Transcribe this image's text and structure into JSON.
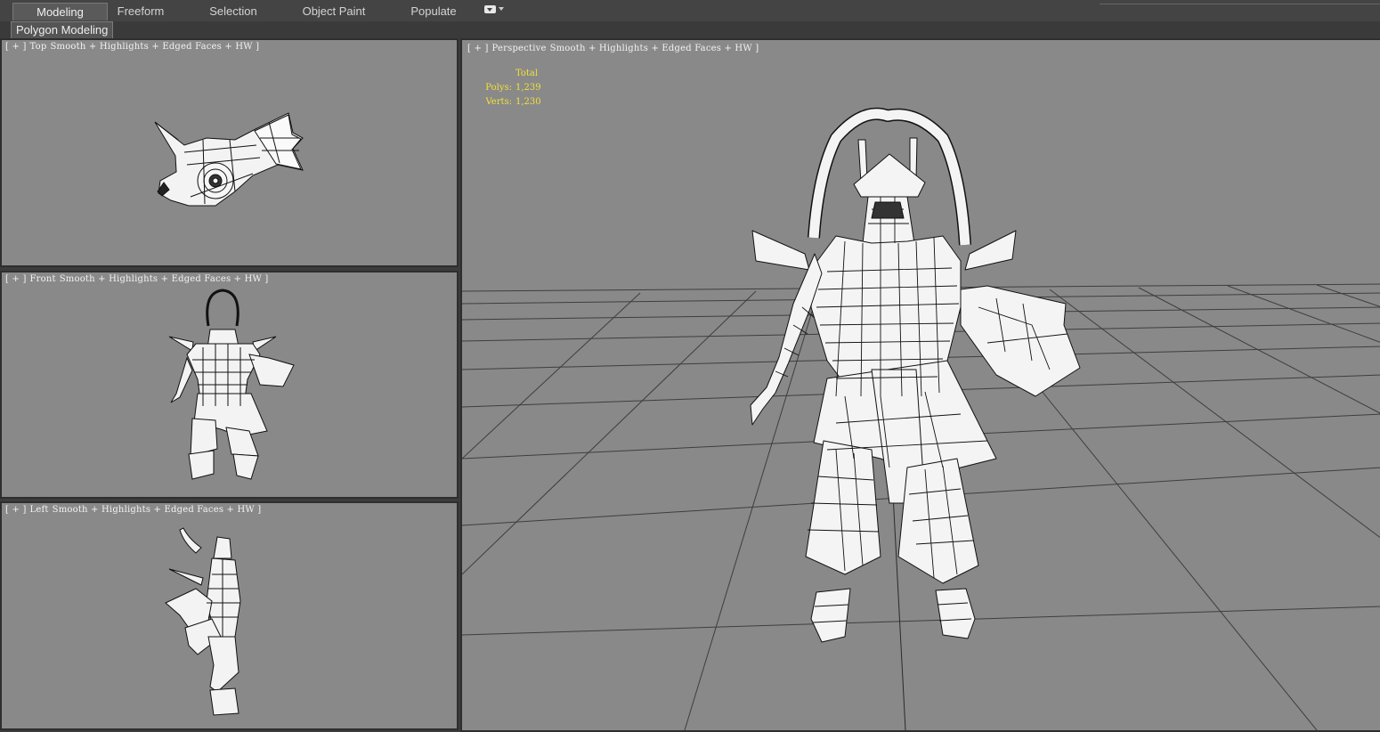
{
  "ribbon": {
    "tabs": [
      {
        "label": "Modeling",
        "active": true
      },
      {
        "label": "Freeform",
        "active": false
      },
      {
        "label": "Selection",
        "active": false
      },
      {
        "label": "Object Paint",
        "active": false
      },
      {
        "label": "Populate",
        "active": false
      }
    ],
    "options_icon": "ribbon-options-icon",
    "subtab": "Polygon Modeling"
  },
  "viewports": {
    "top": {
      "plus": "[ + ]",
      "name": "Top",
      "shading": "Smooth + Highlights + Edged Faces + HW ]"
    },
    "front": {
      "plus": "[ + ]",
      "name": "Front",
      "shading": "Smooth + Highlights + Edged Faces + HW ]"
    },
    "left": {
      "plus": "[ + ]",
      "name": "Left",
      "shading": "Smooth + Highlights + Edged Faces + HW ]"
    },
    "perspective": {
      "plus": "[ + ]",
      "name": "Perspective",
      "shading": "Smooth + Highlights + Edged Faces + HW ]"
    }
  },
  "stats": {
    "header": "Total",
    "polys_label": "Polys:",
    "polys_value": "1,239",
    "verts_label": "Verts:",
    "verts_value": "1,230"
  },
  "colors": {
    "viewport_bg": "#898989",
    "stats_text": "#f0e03c",
    "grid_line": "#3a3a3a",
    "model_fill": "#f4f4f4",
    "wire": "#111111"
  }
}
